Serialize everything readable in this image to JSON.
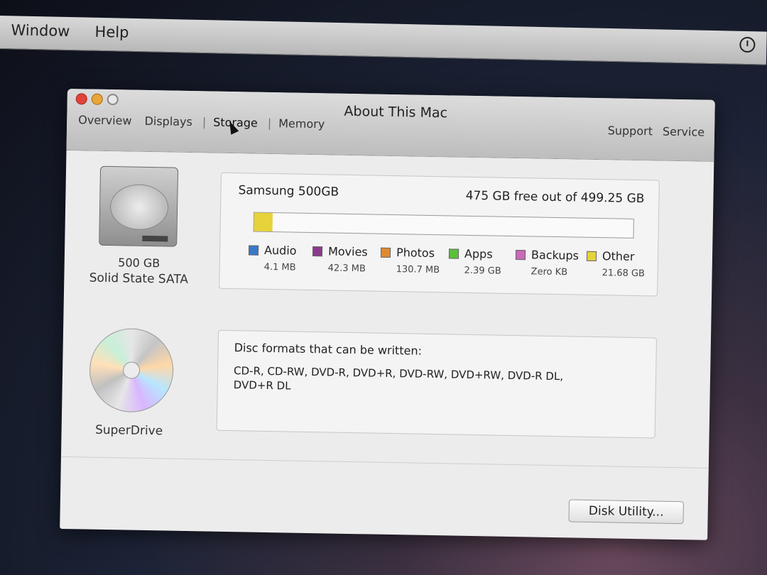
{
  "menubar": {
    "items": [
      {
        "label": "Window"
      },
      {
        "label": "Help"
      }
    ]
  },
  "window": {
    "title": "About This Mac",
    "tabs": [
      {
        "label": "Overview"
      },
      {
        "label": "Displays"
      },
      {
        "label": "Storage"
      },
      {
        "label": "Memory"
      }
    ],
    "active_tab": "Storage",
    "links": [
      {
        "label": "Support"
      },
      {
        "label": "Service"
      }
    ]
  },
  "storage": {
    "drive_caption_1": "500 GB",
    "drive_caption_2": "Solid State SATA",
    "disk_name": "Samsung 500GB",
    "free_text": "475 GB free out of 499.25 GB",
    "used_fraction": 0.049,
    "legend": [
      {
        "label": "Audio",
        "value": "4.1 MB",
        "color": "#3a78c8"
      },
      {
        "label": "Movies",
        "value": "42.3 MB",
        "color": "#8a3a8a"
      },
      {
        "label": "Photos",
        "value": "130.7 MB",
        "color": "#e08a30"
      },
      {
        "label": "Apps",
        "value": "2.39 GB",
        "color": "#5bbf3a"
      },
      {
        "label": "Backups",
        "value": "Zero KB",
        "color": "#c86ab8"
      },
      {
        "label": "Other",
        "value": "21.68 GB",
        "color": "#e6d23a"
      }
    ]
  },
  "superdrive": {
    "caption": "SuperDrive",
    "formats_title": "Disc formats that can be written:",
    "formats_line1": "CD-R, CD-RW, DVD-R, DVD+R, DVD-RW, DVD+RW, DVD-R DL,",
    "formats_line2": "DVD+R DL"
  },
  "buttons": {
    "disk_utility": "Disk Utility..."
  }
}
